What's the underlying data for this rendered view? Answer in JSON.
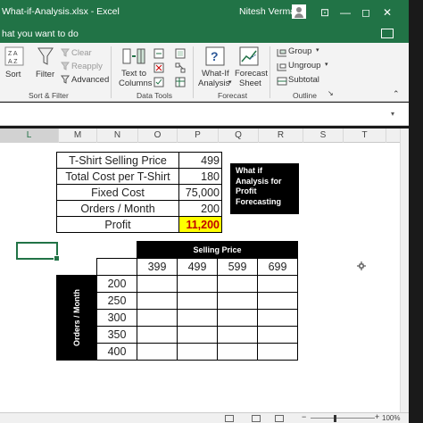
{
  "window": {
    "title": "What-if-Analysis.xlsx  -  Excel",
    "user": "Nitesh Verma",
    "buttons": {
      "ribbon_options": "⊡",
      "minimize": "—",
      "maximize": "◻",
      "close": "✕"
    }
  },
  "tell_me": {
    "text": "hat you want to do"
  },
  "ribbon": {
    "sort": "Sort",
    "filter": "Filter",
    "clear": "Clear",
    "reapply": "Reapply",
    "advanced": "Advanced",
    "text_to_columns_1": "Text to",
    "text_to_columns_2": "Columns",
    "what_if_1": "What-If",
    "what_if_2": "Analysis",
    "forecast_sheet_1": "Forecast",
    "forecast_sheet_2": "Sheet",
    "group": "Group",
    "ungroup": "Ungroup",
    "subtotal": "Subtotal",
    "groups": {
      "sort_filter": "Sort & Filter",
      "data_tools": "Data Tools",
      "forecast": "Forecast",
      "outline": "Outline"
    },
    "colors": {
      "accent": "#217346",
      "ribbon_bg": "#f3f3f3"
    }
  },
  "columns": [
    "L",
    "M",
    "N",
    "O",
    "P",
    "Q",
    "R",
    "S",
    "T"
  ],
  "inputs": {
    "rows": [
      {
        "label": "T-Shirt Selling Price",
        "value": "499"
      },
      {
        "label": "Total Cost per T-Shirt",
        "value": "180"
      },
      {
        "label": "Fixed Cost",
        "value": "75,000"
      },
      {
        "label": "Orders / Month",
        "value": "200"
      },
      {
        "label": "Profit",
        "value": "11,200"
      }
    ]
  },
  "note": {
    "line1": "What if",
    "line2": "Analysis for",
    "line3": "Profit",
    "line4": "Forecasting"
  },
  "data_table": {
    "selling_price_header": "Selling Price",
    "orders_header": "Orders / Month",
    "prices": [
      "399",
      "499",
      "599",
      "699"
    ],
    "orders": [
      "200",
      "250",
      "300",
      "350",
      "400"
    ]
  },
  "status": {
    "zoom": "100%"
  }
}
